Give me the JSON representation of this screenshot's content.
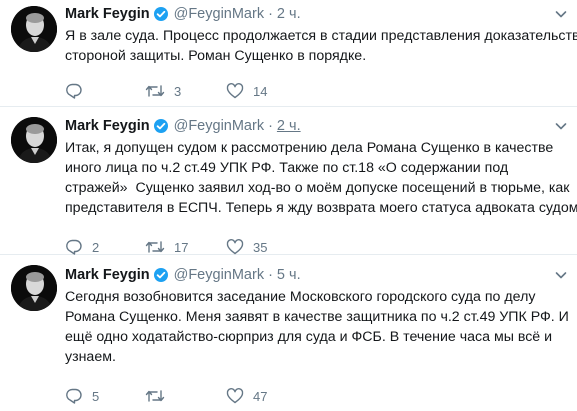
{
  "tweets": [
    {
      "name": "Mark Feygin",
      "handle": "@FeyginMark",
      "dot": "·",
      "time": "2 ч.",
      "lines": [
        "Я в зале суда. Процесс продолжается в стадии представления доказательств",
        "стороной защиты. Роман Сущенко в порядке."
      ],
      "replies": "",
      "retweets": "3",
      "likes": "14"
    },
    {
      "name": "Mark Feygin",
      "handle": "@FeyginMark",
      "dot": "·",
      "time": "2 ч.",
      "lines": [
        "Итак, я допущен судом к рассмотрению дела Романа Сущенко в качестве",
        "иного лица по ч.2 ст.49 УПК РФ. Также по ст.18 «О содержании под",
        "стражей»  Сущенко заявил ход-во о моём допуске посещений в тюрьме, как",
        "представителя в ЕСПЧ. Теперь я жду возврата моего статуса адвоката судом."
      ],
      "replies": "2",
      "retweets": "17",
      "likes": "35"
    },
    {
      "name": "Mark Feygin",
      "handle": "@FeyginMark",
      "dot": "·",
      "time": "5 ч.",
      "lines": [
        "Сегодня возобновится заседание Московского городского суда по делу",
        "Романа Сущенко. Меня заявят в качестве защитника по ч.2 ст.49 УПК РФ. И",
        "ещё одно ходатайство-сюрприз для суда и ФСБ. В течение часа мы всё и",
        "узнаем."
      ],
      "replies": "5",
      "retweets": "",
      "likes": "47"
    }
  ],
  "icons": {
    "reply": "reply-icon",
    "retweet": "retweet-icon",
    "like": "heart-icon",
    "verified": "verified-badge-icon",
    "menu": "chevron-down-icon"
  },
  "colors": {
    "muted": "#657786",
    "verified": "#1da1f2",
    "border": "#e6ecf0",
    "text": "#14171a"
  }
}
